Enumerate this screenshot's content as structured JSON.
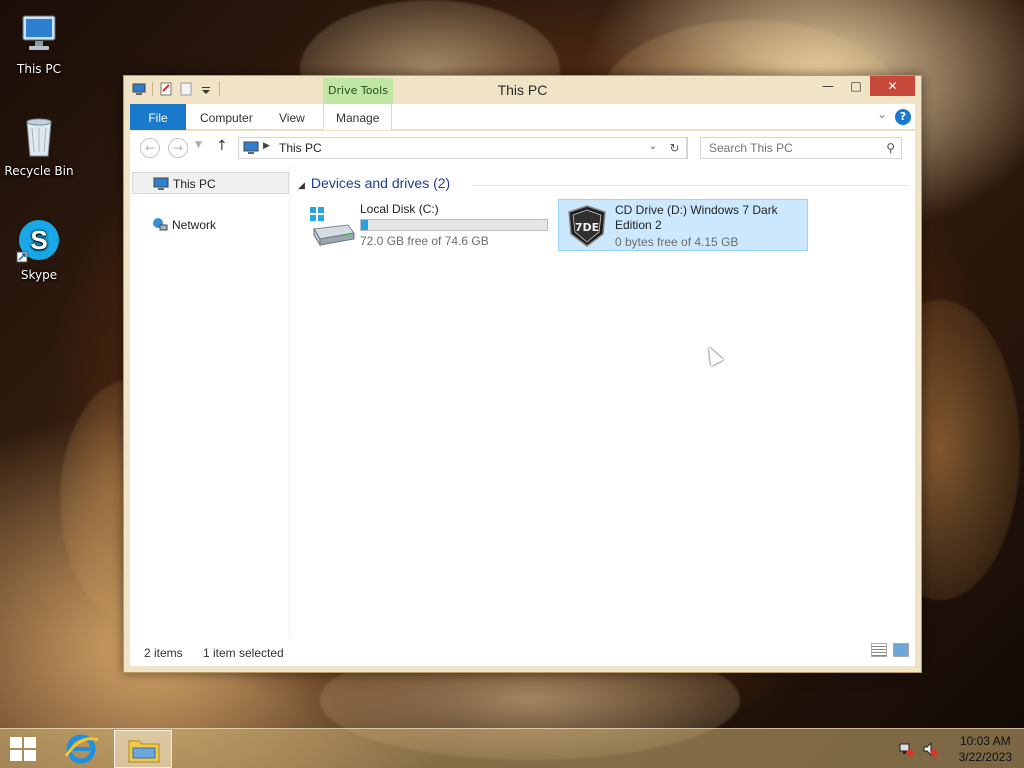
{
  "desktop": {
    "icons": [
      {
        "label": "This PC",
        "icon": "computer-icon"
      },
      {
        "label": "Recycle Bin",
        "icon": "recycle-bin-icon"
      },
      {
        "label": "Skype",
        "icon": "skype-icon"
      }
    ]
  },
  "window": {
    "title": "This PC",
    "contextual_tab": "Drive Tools",
    "ribbon_tabs": [
      "File",
      "Computer",
      "View",
      "Manage"
    ],
    "help_label": "?",
    "address": "This PC",
    "search_placeholder": "Search This PC",
    "nav_items": [
      {
        "label": "This PC",
        "icon": "computer-icon",
        "selected": true
      },
      {
        "label": "Network",
        "icon": "network-icon",
        "selected": false
      }
    ],
    "group_header": "Devices and drives (2)",
    "drives": [
      {
        "name": "Local Disk (C:)",
        "free": "72.0 GB free of 74.6 GB",
        "used_fraction": 0.035,
        "icon": "hard-drive-icon",
        "selected": false
      },
      {
        "name": "CD Drive (D:) Windows 7 Dark Edition 2",
        "free": "0 bytes free of 4.15 GB",
        "icon": "cd-drive-icon",
        "selected": true
      }
    ],
    "status": {
      "items": "2 items",
      "selected": "1 item selected"
    }
  },
  "taskbar": {
    "apps": [
      {
        "name": "internet-explorer-icon",
        "active": false
      },
      {
        "name": "file-explorer-icon",
        "active": true
      }
    ],
    "clock": {
      "time": "10:03 AM",
      "date": "3/22/2023"
    }
  },
  "colors": {
    "accent": "#1979ca",
    "selection": "#cce8ff",
    "context_tab": "#bfe6a3",
    "close": "#c7493a"
  }
}
